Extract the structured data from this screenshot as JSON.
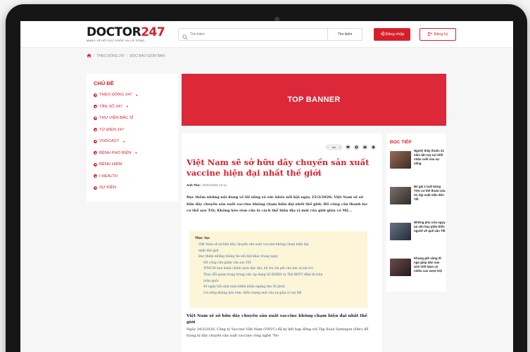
{
  "header": {
    "logo_main": "DOCTOR",
    "logo_number": "247",
    "logo_tagline": "MẠNG XÃ HỘI SỨC KHỎE VÀ LỐI SỐNG",
    "search_placeholder": "Tìm kiếm",
    "search_button": "Tìm kiếm",
    "login_label": "Đăng nhập",
    "signup_label": "Đăng ký"
  },
  "breadcrumb": {
    "items": [
      "THEO DÒNG 247",
      "ĐỌC BÁO GIÙM BẠN"
    ]
  },
  "sidebar": {
    "title": "CHỦ ĐỀ",
    "items": [
      {
        "label": "THEO DÒNG 247",
        "caret": "▼"
      },
      {
        "label": "TẦN SỐ 247",
        "caret": "▼"
      },
      {
        "label": "THƯ VIỆN BÁC SĨ",
        "caret": ""
      },
      {
        "label": "TỪ ĐIỂN 247",
        "caret": ""
      },
      {
        "label": "VODCAST",
        "caret": "▼"
      },
      {
        "label": "BỆNH PHỔ BIẾN",
        "caret": "▼"
      },
      {
        "label": "BỆNH HIẾM",
        "caret": ""
      },
      {
        "label": "I-HEALTH",
        "caret": ""
      },
      {
        "label": "SỰ KIỆN",
        "caret": ""
      }
    ]
  },
  "banner": {
    "label": "TOP BANNER"
  },
  "article": {
    "font_size_label": "aA",
    "title": "Việt Nam sẽ sở hữu dây chuyền sản xuất vaccine hiện đại nhất thế giới",
    "author": "Anh Thư",
    "timestamp": "25/02/2026 10:11",
    "sapo": "Đọc thêm những nội dung về lối sống và sức khỏe nổi bật ngày 25/2/2026: Việt Nam sẽ sở hữu dây chuyền sản xuất vaccine không chạm hiện đại nhất thế giới; Hồ cùng cần thanh lọc cơ thể sau Tết; Không kéo rèm cửa là cách thể hiện địa vị mới của giới giàu có Mỹ...",
    "toc": {
      "heading": "Mục lục",
      "items": [
        {
          "level": 1,
          "text": "Việt Nam sẽ sở hữu dây chuyền sản xuất vaccine không chạm hiện đại"
        },
        {
          "level": 1,
          "text": "nhất thế giới"
        },
        {
          "level": 1,
          "text": "Đọc thêm những thông tin nổi bật khác trong ngày"
        },
        {
          "level": 2,
          "text": "Hồ công cần giảm cân sau Tết"
        },
        {
          "level": 2,
          "text": "TPHCM ban hành chính sách đặc thù, hỗ trợ chi phí cho bác sĩ nội trú"
        },
        {
          "level": 2,
          "text": "Thay đổi quan trọng trong việc áp dụng Số BHXH và Thẻ BHYT điện tử trên"
        },
        {
          "level": 2,
          "text": "toàn quốc"
        },
        {
          "level": 2,
          "text": "40 ngày hồi sinh nam bệnh nhân ngừng tim 30 phút"
        },
        {
          "level": 2,
          "text": "Lối sống không kéo rèm: Biểu tượng mới của sự giàu có tại Mỹ"
        }
      ]
    },
    "section_heading": "Việt Nam sẽ sở hữu dây chuyền sản xuất vaccine không chạm hiện đại nhất thế giới",
    "section_body": "Ngày 24/2/2026, Công ty Vaccine Việt Nam (VNVC) đã ký kết hợp đồng với Tập đoàn Syntegon (Đức) để trang bị dây chuyền sản xuất vaccine công nghệ \"No"
  },
  "related": {
    "title": "ĐỌC TIẾP",
    "items": [
      {
        "text": "Người thầy thuốc 31 năm tận tụy tại chốt chặn cuối của sự sống",
        "thumb_color": "#7a4b3a"
      },
      {
        "text": "Bé gái 2 tuổi bỏng 70% cơ thể thoát cửa tử, kịp xuất viện đón Tết",
        "thumb_color": "#5c5550"
      },
      {
        "text": "Những pha cứu nguy tại sân bay giữa biển người về quê cận Tết",
        "thumb_color": "#3e4a5a"
      },
      {
        "text": "Khung giờ vàng đi ngủ giúp dàn sao U23 Việt Nam có chiều cao vượt trội",
        "thumb_color": "#4a3b3b"
      }
    ]
  },
  "colors": {
    "brand_red": "#d71f2b",
    "banner_red": "#dc2839",
    "toc_bg": "#fdf5d7",
    "link_blue": "#2f67b0"
  }
}
